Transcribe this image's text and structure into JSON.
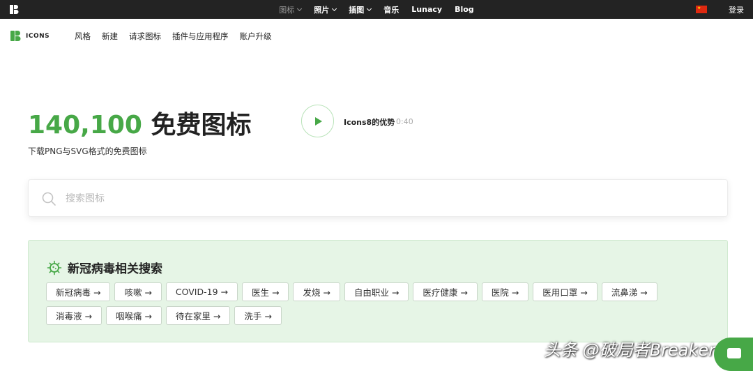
{
  "topbar": {
    "nav": [
      {
        "label": "图标",
        "dropdown": true,
        "active": true
      },
      {
        "label": "照片",
        "dropdown": true,
        "active": false
      },
      {
        "label": "插图",
        "dropdown": true,
        "active": false
      },
      {
        "label": "音乐",
        "dropdown": false,
        "active": false
      },
      {
        "label": "Lunacy",
        "dropdown": false,
        "active": false
      },
      {
        "label": "Blog",
        "dropdown": false,
        "active": false
      }
    ],
    "flag_icon": "china-flag-icon",
    "login": "登录"
  },
  "brand": {
    "name": "ICONS",
    "color": "#47a847"
  },
  "menu": [
    "风格",
    "新建",
    "请求图标",
    "插件与应用程序",
    "账户升级"
  ],
  "hero": {
    "count": "140,100",
    "title_rest": "免费图标",
    "subtitle": "下载PNG与SVG格式的免费图标",
    "video_label": "Icons8的优势",
    "video_duration": "0:40"
  },
  "search": {
    "placeholder": "搜索图标"
  },
  "covid": {
    "title": "新冠病毒相关搜索",
    "tags": [
      "新冠病毒 →",
      "咳嗽 →",
      "COVID-19 →",
      "医生 →",
      "发烧 →",
      "自由职业 →",
      "医疗健康 →",
      "医院 →",
      "医用口罩 →",
      "流鼻涕 →",
      "消毒液 →",
      "咽喉痛 →",
      "待在家里 →",
      "洗手 →"
    ]
  },
  "watermark": "头条 @破局者Breaker",
  "colors": {
    "accent": "#47a847",
    "topbar": "#232323",
    "panel": "#e6f5e6"
  }
}
